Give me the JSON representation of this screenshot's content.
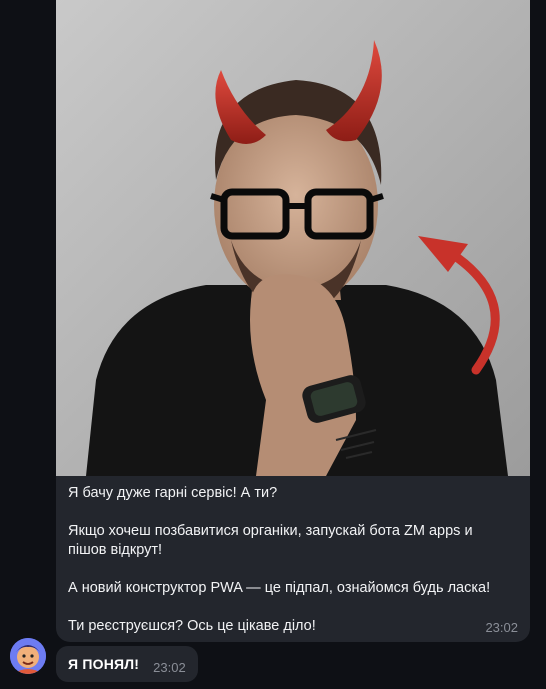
{
  "message": {
    "paragraphs": [
      "Я бачу дуже гарні сервіс! А ти?",
      "Якщо хочеш позбавитися органіки, запускай бота ZM apps и\nпішов відкрут!",
      "А новий конструктор PWA — це підпал, ознайомся будь ласка!",
      "Ти реєструєшся? Ось це цікаве діло!"
    ],
    "time": "23:02",
    "image_icon": "devil-horns-portrait"
  },
  "reply": {
    "text": "Я ПОНЯЛ!",
    "time": "23:02"
  },
  "avatar": {
    "icon": "user-avatar-cartoon"
  },
  "colors": {
    "background": "#0e1015",
    "bubble": "#23262d",
    "text": "#f2f3f5",
    "time": "#8a8e97",
    "horn_red": "#c8322a"
  }
}
